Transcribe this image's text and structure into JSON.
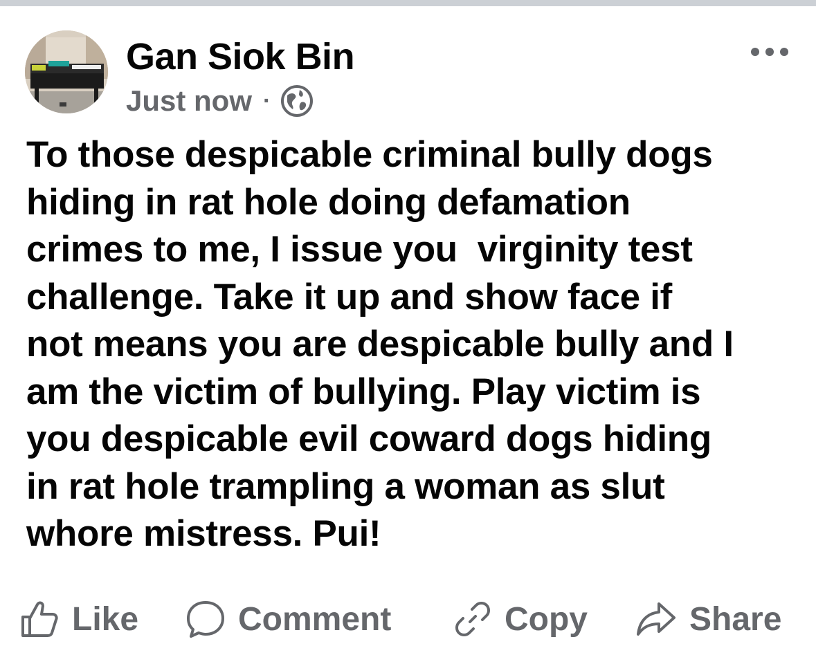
{
  "post": {
    "author": "Gan Siok Bin",
    "timestamp": "Just now",
    "separator": "·",
    "audience_icon": "globe-icon",
    "more_icon": "more-options-icon",
    "lines": [
      "To those despicable criminal bully dogs",
      "hiding in rat hole doing defamation",
      "crimes to me, I issue you  virginity test",
      "challenge. Take it up and show face if",
      "not means you are despicable bully and I",
      "am the victim of bullying. Play victim is",
      "you despicable evil coward dogs hiding",
      "in rat hole trampling a woman as slut",
      "whore mistress. Pui!"
    ]
  },
  "actions": {
    "like": {
      "label": "Like",
      "icon": "thumbs-up-icon"
    },
    "comment": {
      "label": "Comment",
      "icon": "comment-bubble-icon"
    },
    "copy": {
      "label": "Copy",
      "icon": "link-icon"
    },
    "share": {
      "label": "Share",
      "icon": "share-arrow-icon"
    }
  },
  "colors": {
    "text": "#050505",
    "secondary": "#65676b",
    "divider": "#ccd0d5"
  }
}
